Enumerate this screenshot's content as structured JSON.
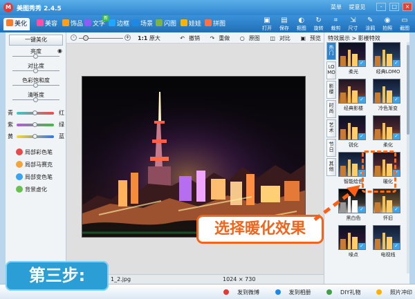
{
  "app": {
    "title": "美图秀秀 2.4.5"
  },
  "top_links": [
    "菜单",
    "提意见"
  ],
  "window_buttons": [
    "-",
    "□",
    "×"
  ],
  "tabs": [
    {
      "label": "美化",
      "color": "#ff7a2a"
    },
    {
      "label": "美容",
      "color": "#ff4da6"
    },
    {
      "label": "饰品",
      "color": "#ff9f1a"
    },
    {
      "label": "文字",
      "color": "#8d5cf6",
      "badge": "新"
    },
    {
      "label": "边框",
      "color": "#1ea7ff"
    },
    {
      "label": "场景",
      "color": "#1e88e5"
    },
    {
      "label": "闪图",
      "color": "#7cb342"
    },
    {
      "label": "娃娃",
      "color": "#ffb300"
    },
    {
      "label": "拼图",
      "color": "#ff7043"
    }
  ],
  "right_tools": [
    {
      "label": "打开",
      "icon": "▣"
    },
    {
      "label": "保存",
      "icon": "▤"
    },
    {
      "label": "抠图",
      "icon": "◐"
    },
    {
      "label": "旋转",
      "icon": "↻"
    },
    {
      "label": "裁剪",
      "icon": "⌗"
    },
    {
      "label": "尺寸",
      "icon": "⇲"
    },
    {
      "label": "涂鸦",
      "icon": "✎"
    },
    {
      "label": "拍照",
      "icon": "◉"
    },
    {
      "label": "截图",
      "icon": "▭"
    }
  ],
  "left": {
    "one_click": "一键美化",
    "adjust_sliders": [
      {
        "label": "亮度",
        "value": 0.5
      },
      {
        "label": "对比度",
        "value": 0.5
      },
      {
        "label": "色彩饱和度",
        "value": 0.5
      },
      {
        "label": "清晰度",
        "value": 0.5
      }
    ],
    "color_sliders": [
      {
        "left": "青",
        "right": "红",
        "value": 0.5,
        "color": "linear-gradient(90deg,#39c9d0,#f24b47)"
      },
      {
        "left": "紫",
        "right": "绿",
        "value": 0.5,
        "color": "linear-gradient(90deg,#b35bd7,#48ba45)"
      },
      {
        "left": "黄",
        "right": "蓝",
        "value": 0.5,
        "color": "linear-gradient(90deg,#ffd532,#3174e8)"
      }
    ],
    "brushes": [
      {
        "label": "局部彩色笔",
        "color": "#e84a4a"
      },
      {
        "label": "局部马赛克",
        "color": "#f3a53a"
      },
      {
        "label": "局部变色笔",
        "color": "#38a4f4"
      },
      {
        "label": "背景虚化",
        "color": "#69c04f"
      }
    ]
  },
  "canvas": {
    "zoom_minus": "-",
    "zoom_plus": "+",
    "zoom_ratio": "1:1",
    "zoom_mode": "原大",
    "zoom_level": 0.15,
    "actions": [
      "撤销",
      "重做",
      "原图",
      "对比",
      "预览"
    ],
    "filename": "1_2.jpg",
    "image_size": "1024 × 730"
  },
  "right": {
    "header": "特效展示 > 影楼特效",
    "vertical_tabs": [
      "热门",
      "LOMO",
      "影楼",
      "时尚",
      "艺术",
      "节日",
      "其他"
    ],
    "effects": [
      {
        "name": "柔光",
        "style": ""
      },
      {
        "name": "经典LOMO",
        "style": "cool"
      },
      {
        "name": "经典影楼",
        "style": "warm"
      },
      {
        "name": "冷色渐变",
        "style": "cool"
      },
      {
        "name": "锐化",
        "style": ""
      },
      {
        "name": "柔化",
        "style": "warm"
      },
      {
        "name": "智能绘色",
        "style": "cool"
      },
      {
        "name": "暖化",
        "style": "warm"
      },
      {
        "name": "黑白色",
        "style": "bw"
      },
      {
        "name": "怀旧",
        "style": "old"
      },
      {
        "name": "噪点",
        "style": ""
      },
      {
        "name": "电视线",
        "style": "cool"
      }
    ]
  },
  "bottom_links": [
    {
      "label": "发到微博",
      "color": "#e53935"
    },
    {
      "label": "发到相册",
      "color": "#1e88e5"
    },
    {
      "label": "DIY礼物",
      "color": "#43a047"
    },
    {
      "label": "照片冲印",
      "color": "#ffb300"
    }
  ],
  "overlay": {
    "step": "第三步:",
    "callout": "选择暖化效果"
  }
}
